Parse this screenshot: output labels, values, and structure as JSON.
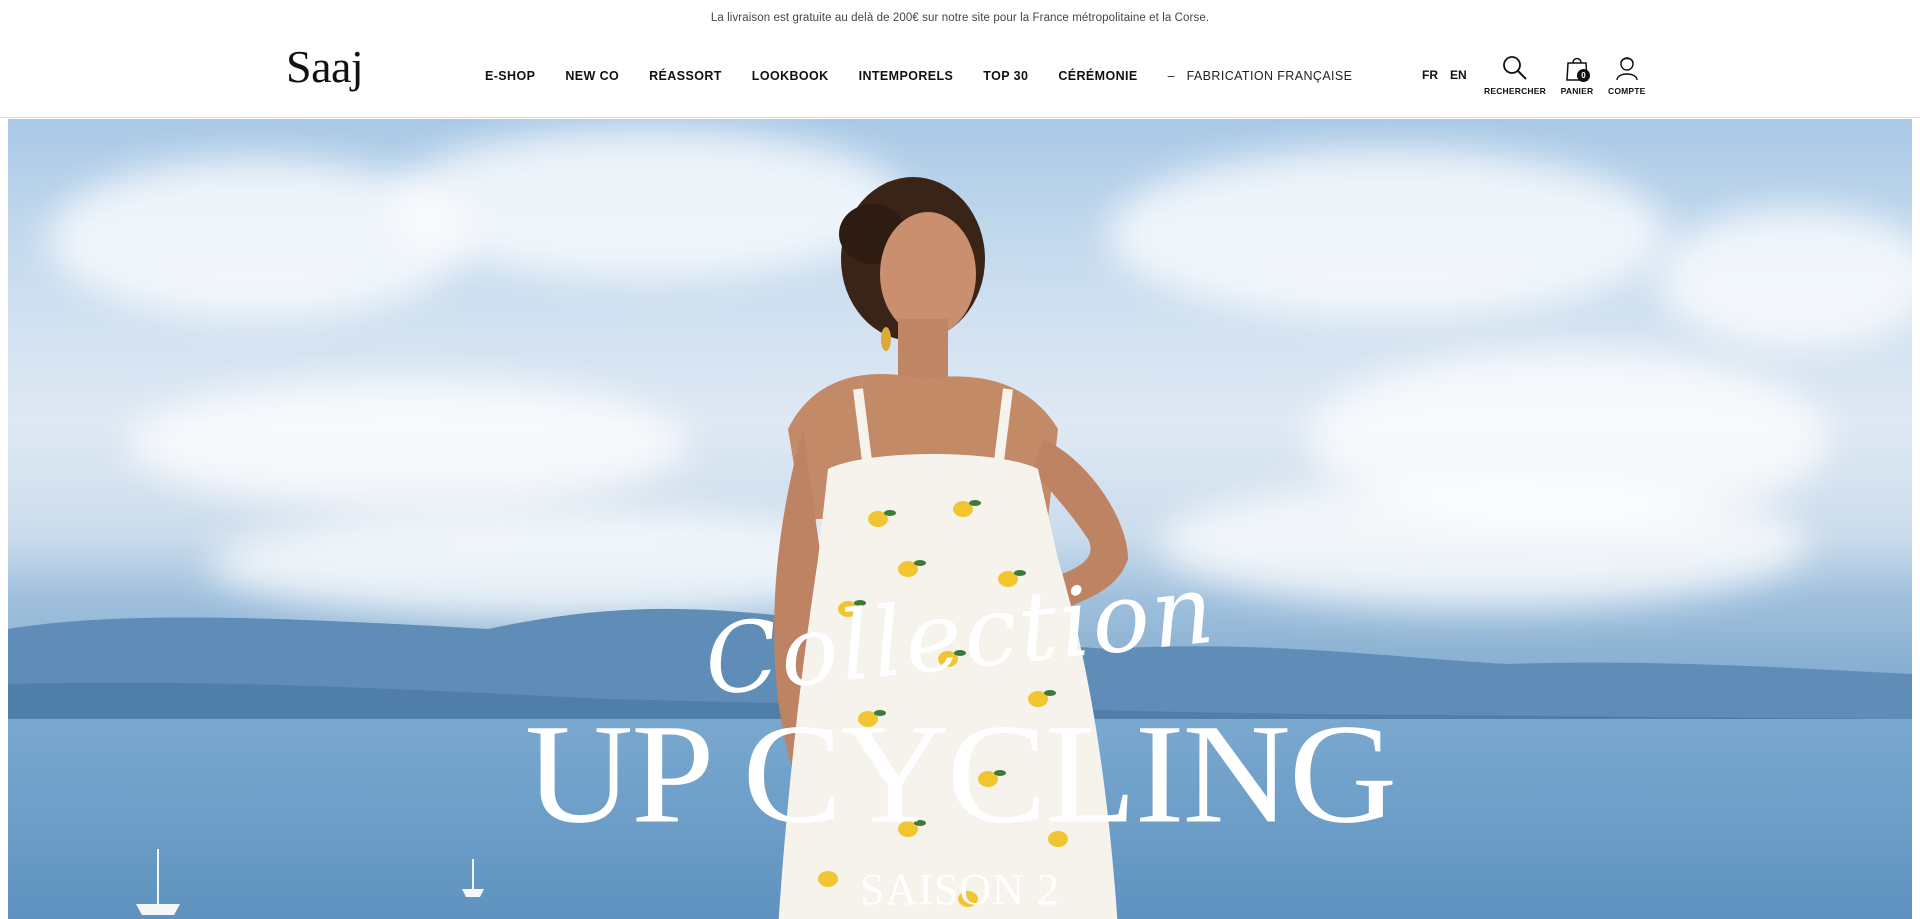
{
  "announcement": "La livraison est gratuite au delà de 200€ sur notre site pour la France métropolitaine et la Corse.",
  "brand": {
    "logo": "Saaj"
  },
  "nav": {
    "items": [
      "E-SHOP",
      "NEW CO",
      "RÉASSORT",
      "LOOKBOOK",
      "INTEMPORELS",
      "TOP 30",
      "CÉRÉMONIE"
    ],
    "separator": "–",
    "extra": "FABRICATION FRANÇAISE"
  },
  "languages": [
    "FR",
    "EN"
  ],
  "actions": {
    "search_label": "RECHERCHER",
    "cart_label": "PANIER",
    "cart_count": "0",
    "account_label": "COMPTE"
  },
  "hero": {
    "script": "Collection",
    "title": "UP CYCLING",
    "subtitle": "SAISON 2"
  },
  "colors": {
    "text": "#111111",
    "sky": "#c8dcef",
    "sea": "#6c9ec8",
    "hero_text": "#ffffff"
  }
}
